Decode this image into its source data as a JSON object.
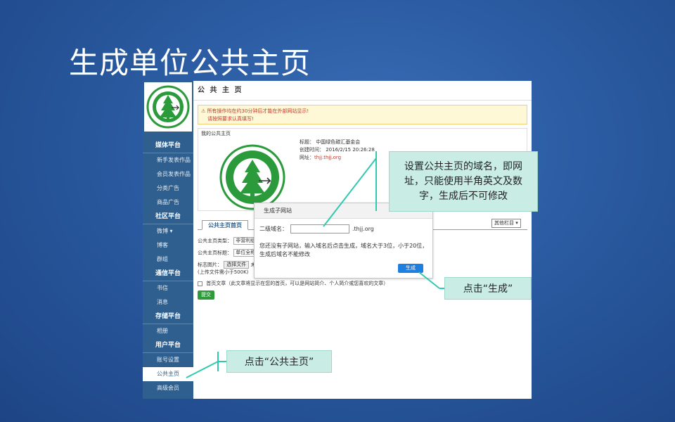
{
  "slide": {
    "title": "生成单位公共主页"
  },
  "sidebar": {
    "sections": [
      {
        "head": "媒体平台",
        "items": [
          "新手发表作品",
          "会员发表作品",
          "分类广告",
          "商品广告"
        ]
      },
      {
        "head": "社区平台",
        "items": [
          "微博 ▾",
          "博客",
          "群组"
        ]
      },
      {
        "head": "通信平台",
        "items": [
          "书信",
          "消息"
        ]
      },
      {
        "head": "存储平台",
        "items": [
          "相册"
        ]
      },
      {
        "head": "用户平台",
        "items": [
          "账号设置",
          "公共主页",
          "高级会员"
        ]
      }
    ],
    "active": "公共主页"
  },
  "main": {
    "header": "公 共 主 页",
    "alert_line1": "所有操作均在约30分钟后才能在外部网站显示!",
    "alert_line2": "请按照要求认真填写!",
    "info_label": "我的公共主页",
    "info_title": "标题：  中国绿色碳汇基金会",
    "info_time": "创建时间：  2016/2/15 20:26:28",
    "info_site_label": "网址：",
    "info_site_value": "thjj.thjj.org",
    "tab_active": "公共主页首页",
    "tab_cut": "X",
    "other_select": "其他栏目 ▾",
    "type_label": "公共主页类型：",
    "type_value": "非营利组",
    "title_label": "公共主页标题：",
    "title_value": "单位全称",
    "image_label": "标志图片：",
    "image_btn": "选择文件",
    "image_suffix": "未",
    "image_note": "(上传文件需小于500K)",
    "homepage_check": "首页文章（此文章将显示在您的首页，可以是网站简介、个人简介或您喜欢的文章）",
    "submit": "提交"
  },
  "dialog": {
    "title": "生成子网站",
    "domain_label": "二级域名：",
    "domain_value": "",
    "domain_suffix": ".thjj.org",
    "desc": "您还没有子网站，输入域名后点击生成，域名大于3位，小于20位，生成后域名不能修改",
    "button": "生成"
  },
  "callouts": {
    "domain": "设置公共主页的域名，即网址，只能使用半角英文及数字，生成后不可修改",
    "generate": "点击“生成”",
    "homepage": "点击“公共主页”"
  },
  "colors": {
    "background": "#2a5aa0",
    "callout": "#c9ede5",
    "sidebar": "#2e5f8e",
    "line": "#2fc9b0"
  }
}
